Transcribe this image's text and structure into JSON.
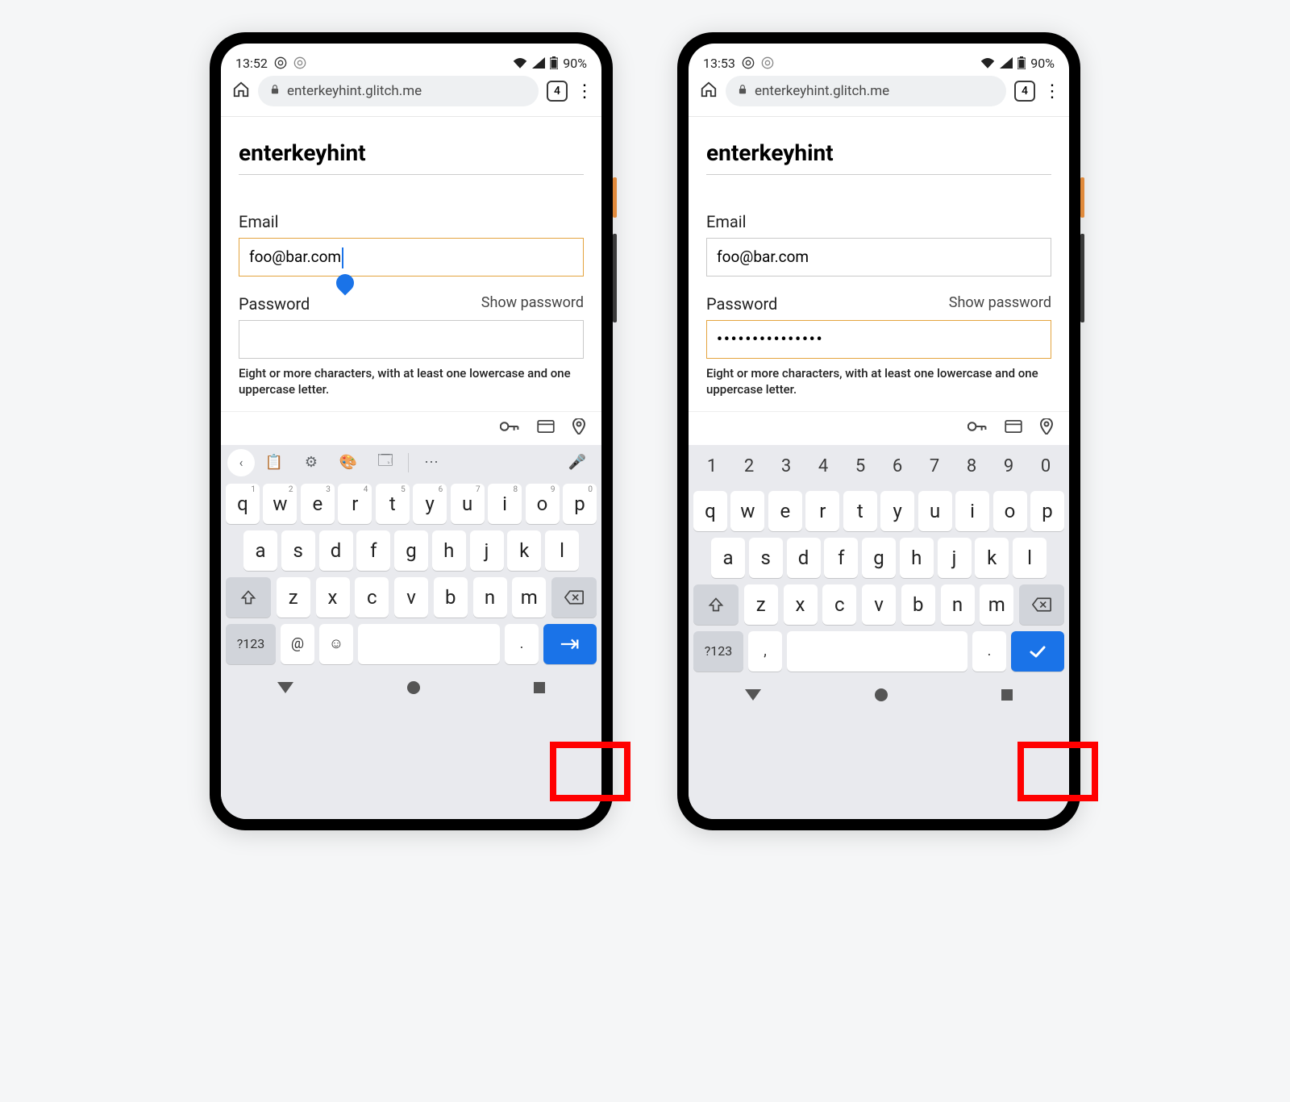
{
  "phones": [
    {
      "status": {
        "time": "13:52",
        "battery": "90%"
      },
      "browser": {
        "url": "enterkeyhint.glitch.me",
        "tab_count": "4"
      },
      "page": {
        "title": "enterkeyhint",
        "email_label": "Email",
        "email_value": "foo@bar.com",
        "password_label": "Password",
        "show_password": "Show password",
        "password_value": "",
        "hint": "Eight or more characters, with at least one lowercase and one uppercase letter.",
        "email_focused": true,
        "password_focused": false
      },
      "keyboard": {
        "style": "email",
        "num_row": [
          "1",
          "2",
          "3",
          "4",
          "5",
          "6",
          "7",
          "8",
          "9",
          "0"
        ],
        "row1": [
          "q",
          "w",
          "e",
          "r",
          "t",
          "y",
          "u",
          "i",
          "o",
          "p"
        ],
        "row1_sup": [
          "1",
          "2",
          "3",
          "4",
          "5",
          "6",
          "7",
          "8",
          "9",
          "0"
        ],
        "row2": [
          "a",
          "s",
          "d",
          "f",
          "g",
          "h",
          "j",
          "k",
          "l"
        ],
        "row3": [
          "z",
          "x",
          "c",
          "v",
          "b",
          "n",
          "m"
        ],
        "sym_label": "?123",
        "enter_icon": "next"
      }
    },
    {
      "status": {
        "time": "13:53",
        "battery": "90%"
      },
      "browser": {
        "url": "enterkeyhint.glitch.me",
        "tab_count": "4"
      },
      "page": {
        "title": "enterkeyhint",
        "email_label": "Email",
        "email_value": "foo@bar.com",
        "password_label": "Password",
        "show_password": "Show password",
        "password_value": "•••••••••••••••",
        "hint": "Eight or more characters, with at least one lowercase and one uppercase letter.",
        "email_focused": false,
        "password_focused": true
      },
      "keyboard": {
        "style": "password",
        "num_row": [
          "1",
          "2",
          "3",
          "4",
          "5",
          "6",
          "7",
          "8",
          "9",
          "0"
        ],
        "row1": [
          "q",
          "w",
          "e",
          "r",
          "t",
          "y",
          "u",
          "i",
          "o",
          "p"
        ],
        "row1_sup": [
          "",
          "",
          "",
          "",
          "",
          "",
          "",
          "",
          "",
          ""
        ],
        "row2": [
          "a",
          "s",
          "d",
          "f",
          "g",
          "h",
          "j",
          "k",
          "l"
        ],
        "row3": [
          "z",
          "x",
          "c",
          "v",
          "b",
          "n",
          "m"
        ],
        "sym_label": "?123",
        "enter_icon": "done"
      }
    }
  ]
}
